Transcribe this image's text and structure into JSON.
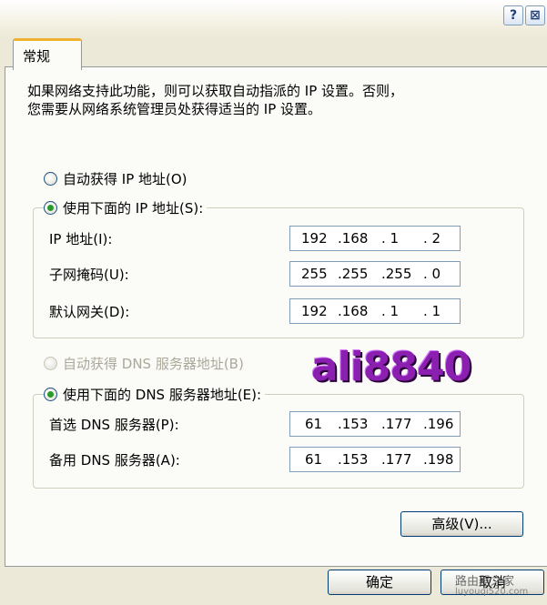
{
  "window": {
    "help_symbol": "?",
    "close_symbol": "⊠"
  },
  "tab": {
    "label": "常规"
  },
  "description": {
    "line1": "如果网络支持此功能，则可以获取自动指派的 IP 设置。否则，",
    "line2": "您需要从网络系统管理员处获得适当的 IP 设置。"
  },
  "ip_section": {
    "auto_label": "自动获得 IP 地址(O)",
    "manual_label": "使用下面的 IP 地址(S):",
    "selected": "manual",
    "fields": [
      {
        "label": "IP 地址(I):",
        "octets": [
          "192",
          ".168",
          ".  1",
          ".  2"
        ]
      },
      {
        "label": "子网掩码(U):",
        "octets": [
          "255",
          ".255",
          ".255",
          ".  0"
        ]
      },
      {
        "label": "默认网关(D):",
        "octets": [
          "192",
          ".168",
          ".  1",
          ".  1"
        ]
      }
    ]
  },
  "dns_section": {
    "auto_label": "自动获得 DNS 服务器地址(B)",
    "manual_label": "使用下面的 DNS 服务器地址(E):",
    "selected": "manual",
    "fields": [
      {
        "label": "首选 DNS 服务器(P):",
        "octets": [
          "61",
          ".153",
          ".177",
          ".196"
        ]
      },
      {
        "label": "备用 DNS 服务器(A):",
        "octets": [
          "61",
          ".153",
          ".177",
          ".198"
        ]
      }
    ]
  },
  "watermark": "ali8840",
  "buttons": {
    "advanced": "高级(V)...",
    "ok": "确定",
    "cancel": "取消"
  },
  "site_mark": {
    "name": "路由器之家",
    "url": "luyouqi520.com"
  }
}
